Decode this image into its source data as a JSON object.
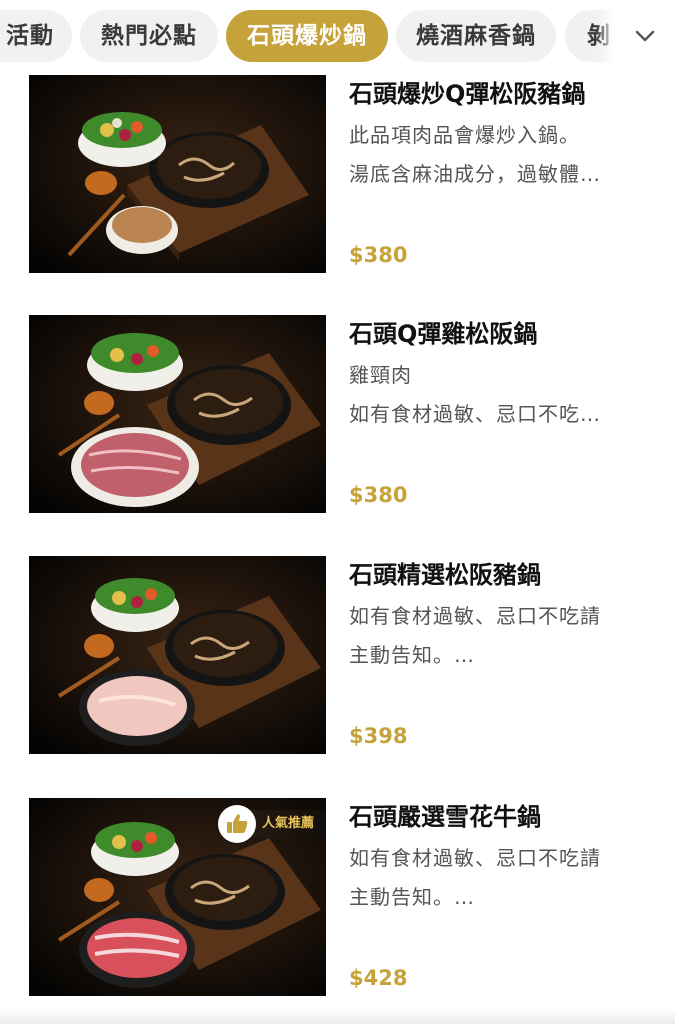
{
  "tabs": [
    {
      "label": "活動"
    },
    {
      "label": "熱門必點"
    },
    {
      "label": "石頭爆炒鍋",
      "active": true
    },
    {
      "label": "燒酒麻香鍋"
    },
    {
      "label": "剝"
    }
  ],
  "tabs_more_icon": "chevron-down-icon",
  "colors": {
    "accent": "#c6a23a",
    "tab_bg": "#f1f1f1",
    "price": "#c6a23a"
  },
  "items": [
    {
      "name": "石頭爆炒Q彈松阪豬鍋",
      "desc_line1": "此品項肉品會爆炒入鍋。",
      "desc_line2": "湯底含麻油成分，過敏體…",
      "price": "$380",
      "image_icon": "hotpot-photo-icon"
    },
    {
      "name": "石頭Q彈雞松阪鍋",
      "desc_line1": "雞頸肉",
      "desc_line2": "如有食材過敏、忌口不吃…",
      "price": "$380",
      "image_icon": "hotpot-photo-icon"
    },
    {
      "name": "石頭精選松阪豬鍋",
      "desc_line1": "如有食材過敏、忌口不吃請",
      "desc_line2": "主動告知。…",
      "price": "$398",
      "image_icon": "hotpot-photo-icon"
    },
    {
      "name": "石頭嚴選雪花牛鍋",
      "desc_line1": "如有食材過敏、忌口不吃請",
      "desc_line2": "主動告知。…",
      "price": "$428",
      "image_icon": "hotpot-photo-icon",
      "badge": "人氣推薦",
      "badge_icon": "thumbs-up-icon"
    }
  ]
}
